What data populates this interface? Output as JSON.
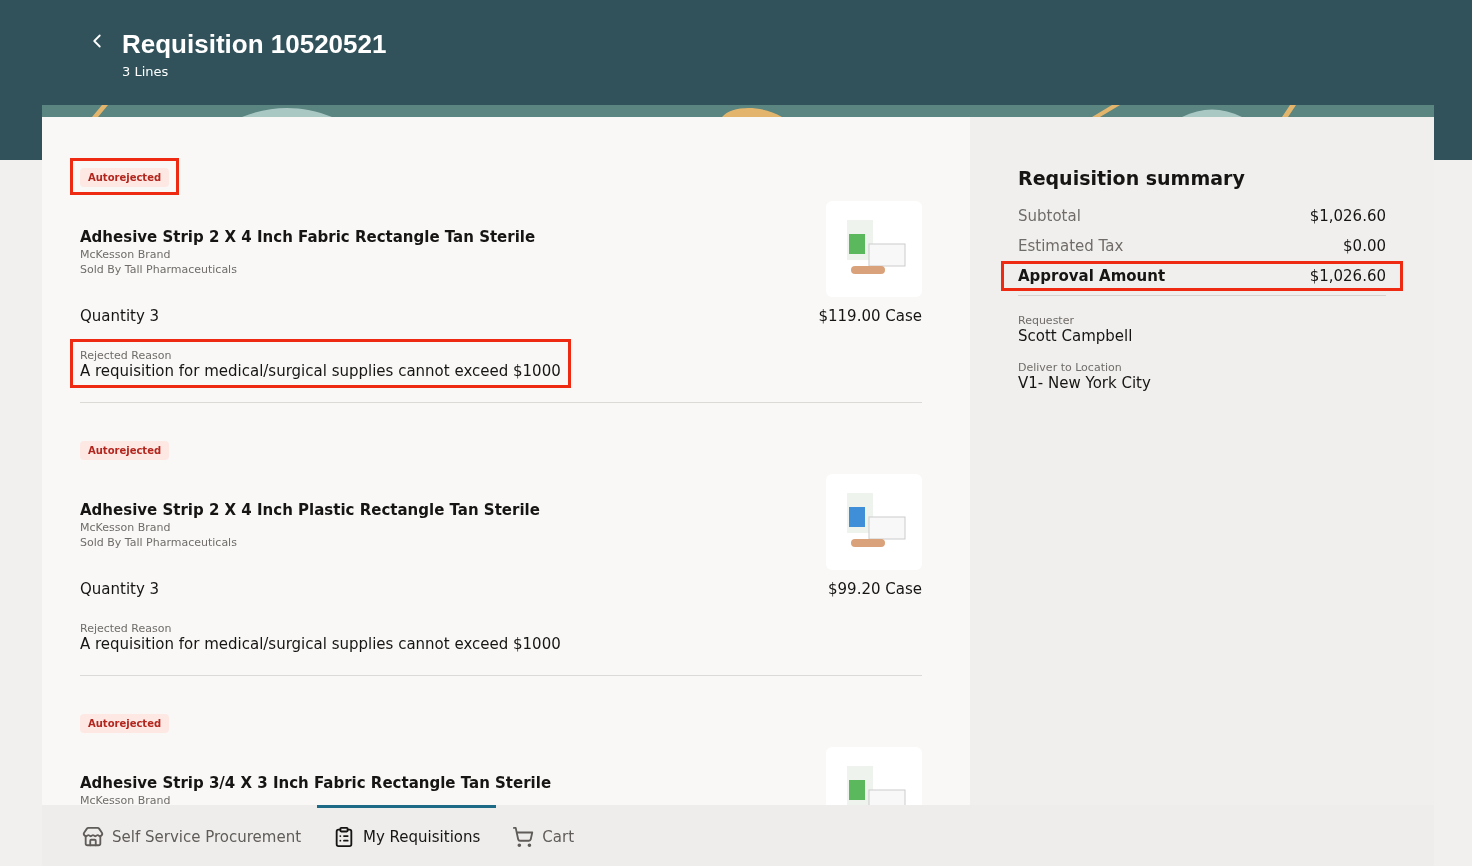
{
  "header": {
    "title": "Requisition 10520521",
    "subtitle": "3 Lines"
  },
  "lines": [
    {
      "status": "Autorejected",
      "status_highlighted": true,
      "name": "Adhesive Strip 2 X 4 Inch Fabric Rectangle Tan Sterile",
      "brand": "McKesson Brand",
      "seller": "Sold By Tall Pharmaceuticals",
      "quantity": "Quantity 3",
      "price": "$119.00 Case",
      "reason_label": "Rejected Reason",
      "reason": "A requisition for medical/surgical supplies cannot exceed $1000",
      "reason_highlighted": true
    },
    {
      "status": "Autorejected",
      "status_highlighted": false,
      "name": "Adhesive Strip 2 X 4 Inch Plastic Rectangle Tan Sterile",
      "brand": "McKesson Brand",
      "seller": "Sold By Tall Pharmaceuticals",
      "quantity": "Quantity 3",
      "price": "$99.20 Case",
      "reason_label": "Rejected Reason",
      "reason": "A requisition for medical/surgical supplies cannot exceed $1000",
      "reason_highlighted": false
    },
    {
      "status": "Autorejected",
      "status_highlighted": false,
      "name": "Adhesive Strip 3/4 X 3 Inch Fabric Rectangle Tan Sterile",
      "brand": "McKesson Brand"
    }
  ],
  "summary": {
    "title": "Requisition summary",
    "rows": [
      {
        "label": "Subtotal",
        "value": "$1,026.60",
        "kind": "plain",
        "highlighted": false
      },
      {
        "label": "Estimated Tax",
        "value": "$0.00",
        "kind": "plain",
        "highlighted": false
      },
      {
        "label": "Approval Amount",
        "value": "$1,026.60",
        "kind": "total",
        "highlighted": true
      }
    ],
    "details": [
      {
        "label": "Requester",
        "value": "Scott Campbell"
      },
      {
        "label": "Deliver to Location",
        "value": "V1- New York City"
      }
    ]
  },
  "nav": [
    {
      "label": "Self Service Procurement",
      "kind": "store",
      "selected": false
    },
    {
      "label": "My Requisitions",
      "kind": "clipboard",
      "selected": true
    },
    {
      "label": "Cart",
      "kind": "cart",
      "selected": false
    }
  ]
}
